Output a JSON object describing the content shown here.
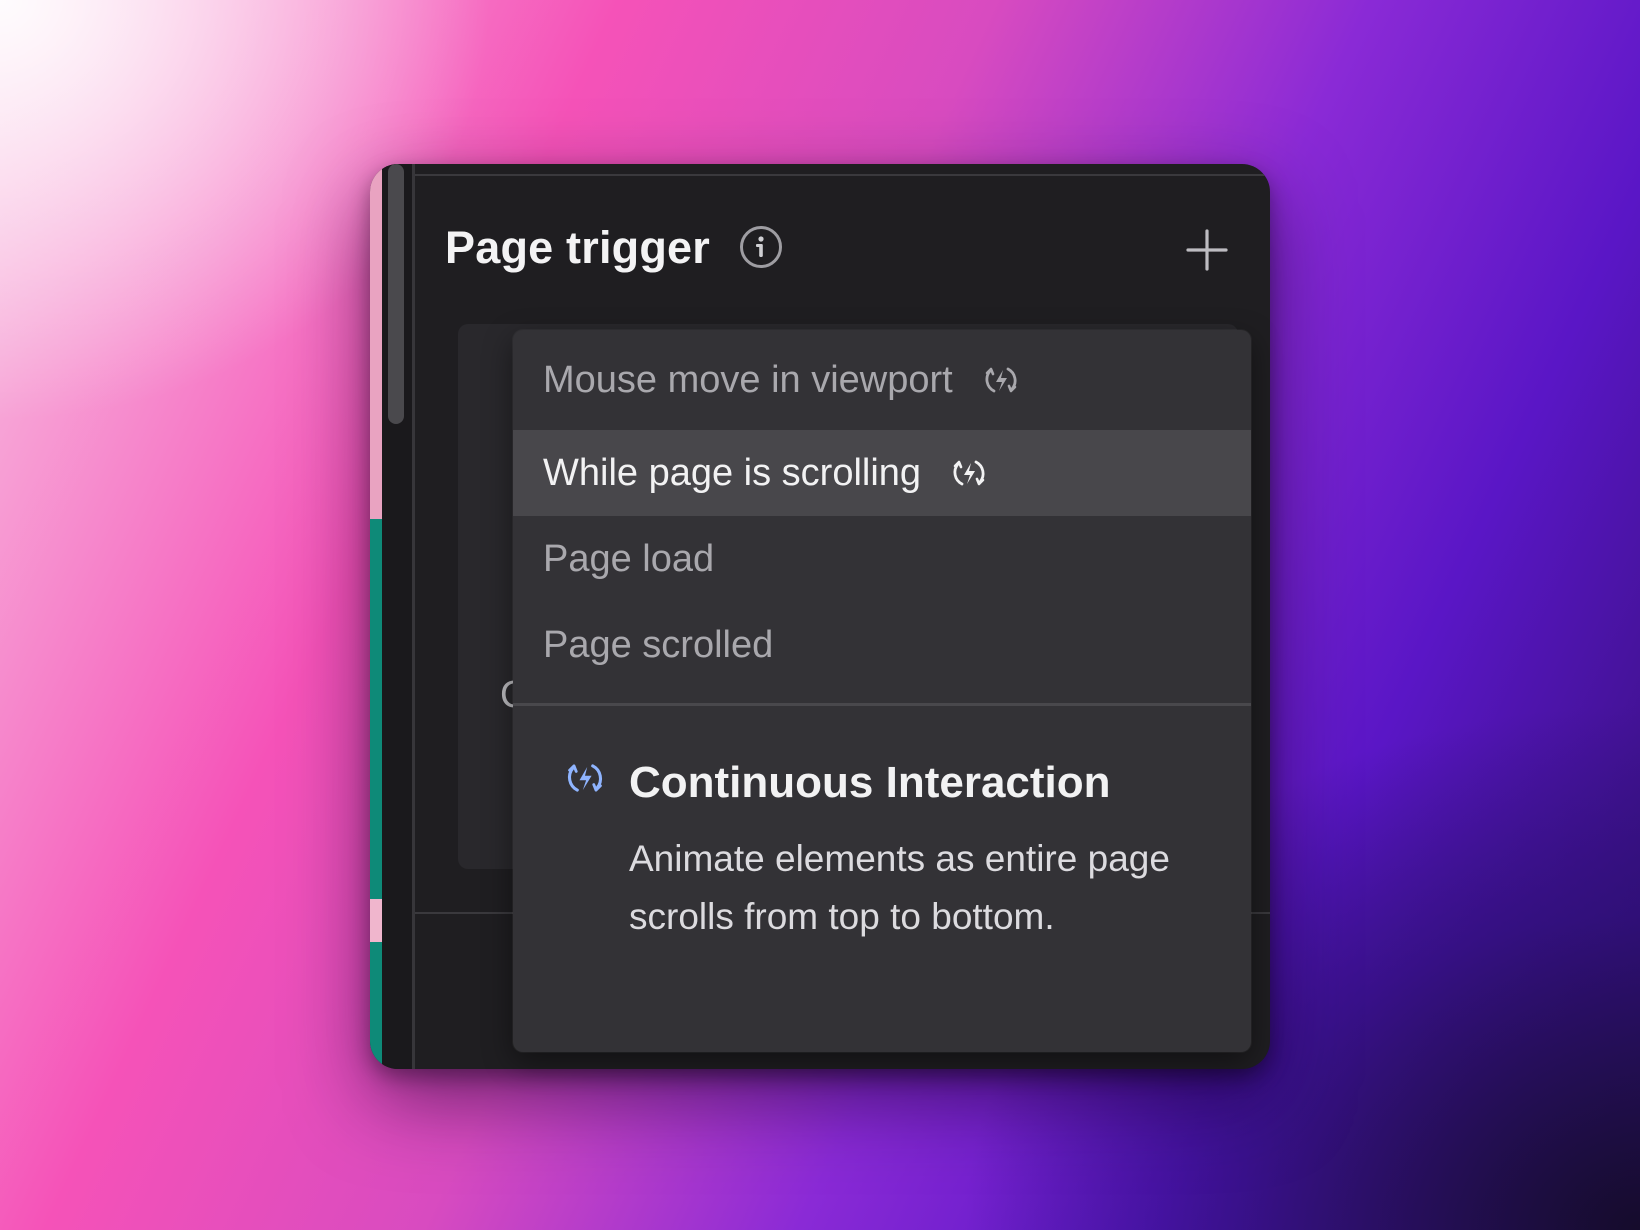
{
  "panel": {
    "title": "Page trigger",
    "info_icon": "info-icon",
    "add_icon": "plus-icon"
  },
  "dropdown": {
    "items": [
      {
        "label": "Mouse move in viewport",
        "continuous": true,
        "selected": false
      },
      {
        "label": "While page is scrolling",
        "continuous": true,
        "selected": true
      },
      {
        "label": "Page load",
        "continuous": false,
        "selected": false
      },
      {
        "label": "Page scrolled",
        "continuous": false,
        "selected": false
      }
    ],
    "tooltip": {
      "icon": "continuous-interaction-icon",
      "title": "Continuous Interaction",
      "description": "Animate elements as entire page scrolls from top to bottom."
    }
  },
  "background_card": {
    "partial_text": "C"
  },
  "colors": {
    "panel_bg": "#1f1e21",
    "dropdown_bg": "#333236",
    "selected_bg": "#48474b",
    "continuous_icon_accent": "#8fb4ff"
  }
}
